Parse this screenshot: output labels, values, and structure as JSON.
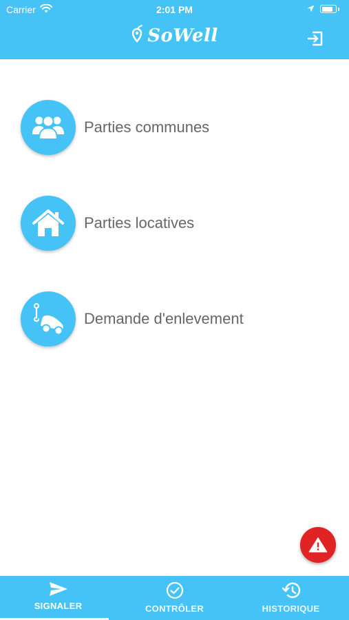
{
  "status": {
    "carrier": "Carrier",
    "time": "2:01 PM"
  },
  "header": {
    "brand": "SoWell"
  },
  "menu": [
    {
      "label": "Parties communes",
      "icon": "group-icon"
    },
    {
      "label": "Parties locatives",
      "icon": "home-icon"
    },
    {
      "label": "Demande d'enlevement",
      "icon": "tow-truck-icon"
    }
  ],
  "tabs": [
    {
      "label": "SIGNALER",
      "icon": "send-icon",
      "active": true
    },
    {
      "label": "CONTRÔLER",
      "icon": "check-circle-icon",
      "active": false
    },
    {
      "label": "HISTORIQUE",
      "icon": "history-icon",
      "active": false
    }
  ],
  "colors": {
    "primary": "#46c3f6",
    "alert": "#e02424",
    "text": "#666666"
  }
}
